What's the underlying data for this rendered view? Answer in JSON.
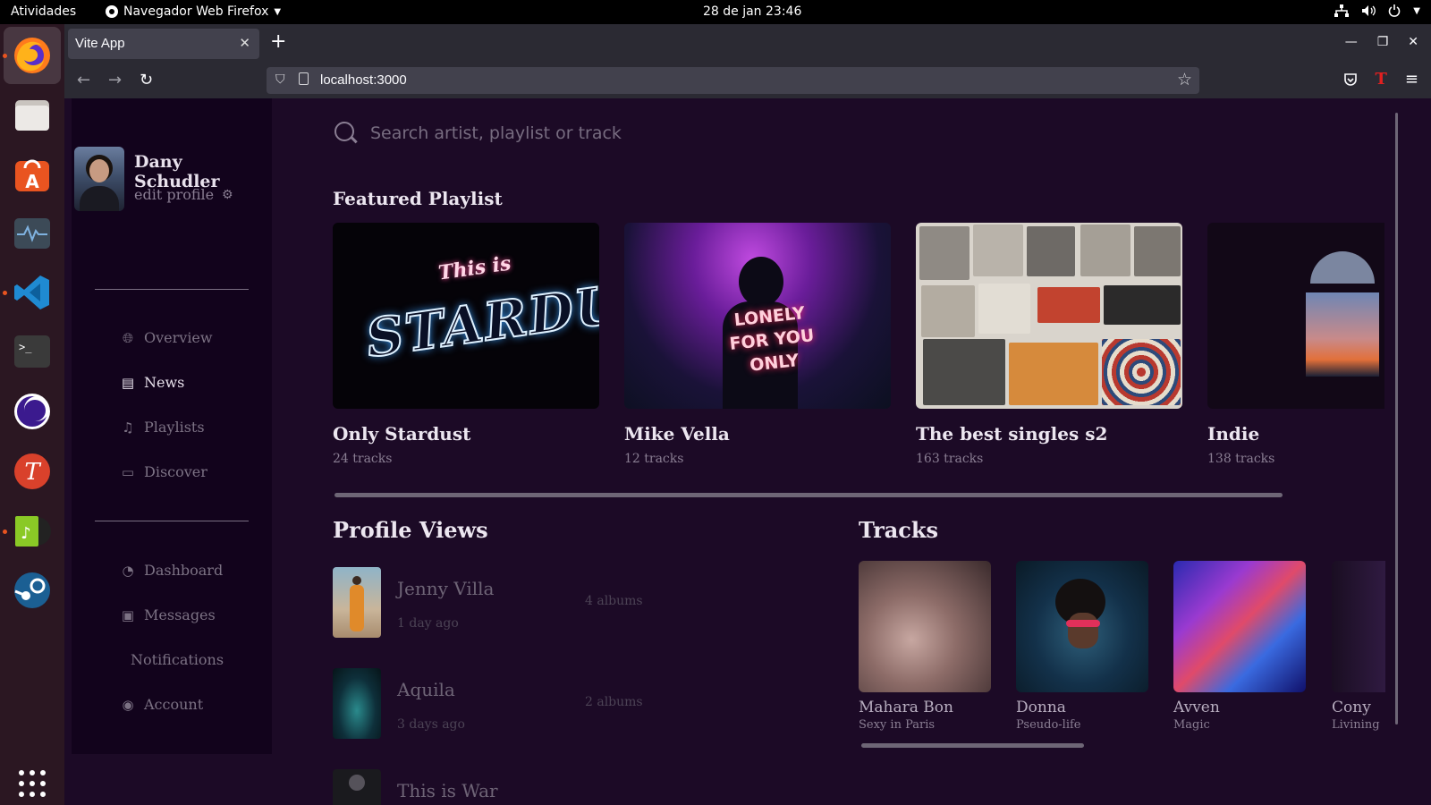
{
  "system": {
    "activities": "Atividades",
    "app_menu": "Navegador Web Firefox",
    "clock": "28 de jan  23:46"
  },
  "browser": {
    "tab_title": "Vite App",
    "url": "localhost:3000"
  },
  "sidebar": {
    "profile_name": "Dany Schudler",
    "edit_profile": "edit profile",
    "menu_main": [
      {
        "label": "Overview",
        "icon": "globe-icon"
      },
      {
        "label": "News",
        "icon": "newspaper-icon"
      },
      {
        "label": "Playlists",
        "icon": "music-note-icon"
      },
      {
        "label": "Discover",
        "icon": "card-icon"
      }
    ],
    "menu_secondary": [
      {
        "label": "Dashboard",
        "icon": "gauge-icon"
      },
      {
        "label": "Messages",
        "icon": "message-icon"
      },
      {
        "label": "Notifications",
        "icon": ""
      },
      {
        "label": "Account",
        "icon": "user-circle-icon"
      }
    ],
    "active_item": "News"
  },
  "search": {
    "placeholder": "Search artist, playlist or track"
  },
  "featured": {
    "title": "Featured Playlist",
    "cover_texts": {
      "stardust_small": "This is",
      "stardust_big": "STARDUST",
      "lonely": "LONELY FOR YOU ONLY"
    },
    "playlists": [
      {
        "title": "Only Stardust",
        "count": "24 tracks"
      },
      {
        "title": "Mike Vella",
        "count": "12 tracks"
      },
      {
        "title": "The best singles s2",
        "count": "163 tracks"
      },
      {
        "title": "Indie",
        "count": "138 tracks"
      }
    ]
  },
  "profile_views": {
    "title": "Profile Views",
    "items": [
      {
        "name": "Jenny Villa",
        "time": "1 day ago",
        "albums": "4 albums"
      },
      {
        "name": "Aquila",
        "time": "3 days ago",
        "albums": "2 albums"
      },
      {
        "name": "This is War",
        "time": "",
        "albums": ""
      }
    ]
  },
  "tracks": {
    "title": "Tracks",
    "items": [
      {
        "title": "Mahara Bon",
        "subtitle": "Sexy in Paris"
      },
      {
        "title": "Donna",
        "subtitle": "Pseudo-life"
      },
      {
        "title": "Avven",
        "subtitle": "Magic"
      },
      {
        "title": "Cony",
        "subtitle": "Livining"
      }
    ]
  },
  "colors": {
    "page_bg": "#1c0a26",
    "sidebar_bg": "#12031c",
    "dock_bg": "#2b1722",
    "ubuntu_orange": "#e95420"
  }
}
